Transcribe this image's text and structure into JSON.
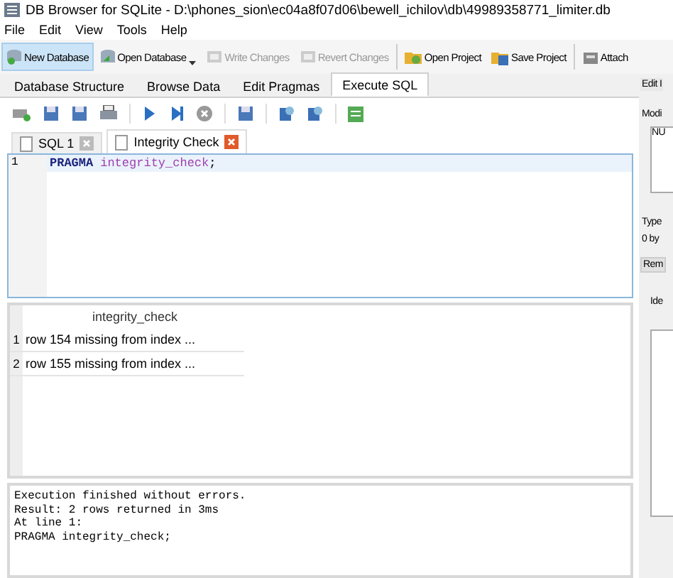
{
  "window": {
    "title": "DB Browser for SQLite - D:\\phones_sion\\ec04a8f07d06\\bewell_ichilov\\db\\49989358771_limiter.db"
  },
  "menu": [
    "File",
    "Edit",
    "View",
    "Tools",
    "Help"
  ],
  "toolbar": [
    {
      "label": "New Database",
      "kind": "new",
      "highlighted": true,
      "disabled": false,
      "dropdown": false
    },
    {
      "label": "Open Database",
      "kind": "open",
      "highlighted": false,
      "disabled": false,
      "dropdown": true
    },
    {
      "label": "Write Changes",
      "kind": "write",
      "highlighted": false,
      "disabled": true,
      "dropdown": false
    },
    {
      "label": "Revert Changes",
      "kind": "revert",
      "highlighted": false,
      "disabled": true,
      "dropdown": false
    },
    {
      "label": "Open Project",
      "kind": "project",
      "highlighted": false,
      "disabled": false,
      "dropdown": false
    },
    {
      "label": "Save Project",
      "kind": "save",
      "highlighted": false,
      "disabled": false,
      "dropdown": false
    },
    {
      "label": "Attach",
      "kind": "attach",
      "highlighted": false,
      "disabled": false,
      "dropdown": false
    }
  ],
  "tabs": [
    {
      "label": "Database Structure",
      "selected": false
    },
    {
      "label": "Browse Data",
      "selected": false
    },
    {
      "label": "Edit Pragmas",
      "selected": false
    },
    {
      "label": "Execute SQL",
      "selected": true
    }
  ],
  "editor_tabs": [
    {
      "label": "SQL 1",
      "selected": false
    },
    {
      "label": "Integrity Check",
      "selected": true
    }
  ],
  "editor": {
    "lines": [
      {
        "number": "1",
        "tokens": [
          {
            "kind": "keyword",
            "text": "PRAGMA"
          },
          {
            "kind": "identifier",
            "text": "integrity_check"
          },
          {
            "kind": "punctuation",
            "text": ";"
          }
        ]
      }
    ]
  },
  "results": {
    "columns": [
      "integrity_check"
    ],
    "rows": [
      {
        "number": "1",
        "cells": [
          "row 154 missing from index ..."
        ]
      },
      {
        "number": "2",
        "cells": [
          "row 155 missing from index ..."
        ]
      }
    ]
  },
  "message": [
    "Execution finished without errors.",
    "Result: 2 rows returned in 3ms",
    "At line 1:",
    "PRAGMA integrity_check;"
  ],
  "side_panel": {
    "title": "Edit I",
    "mode_label": "Modi",
    "cell_value": "NU",
    "type_label": "Type",
    "size_label": "0 by",
    "remove_button": "Rem",
    "identity_label": "Ide"
  }
}
